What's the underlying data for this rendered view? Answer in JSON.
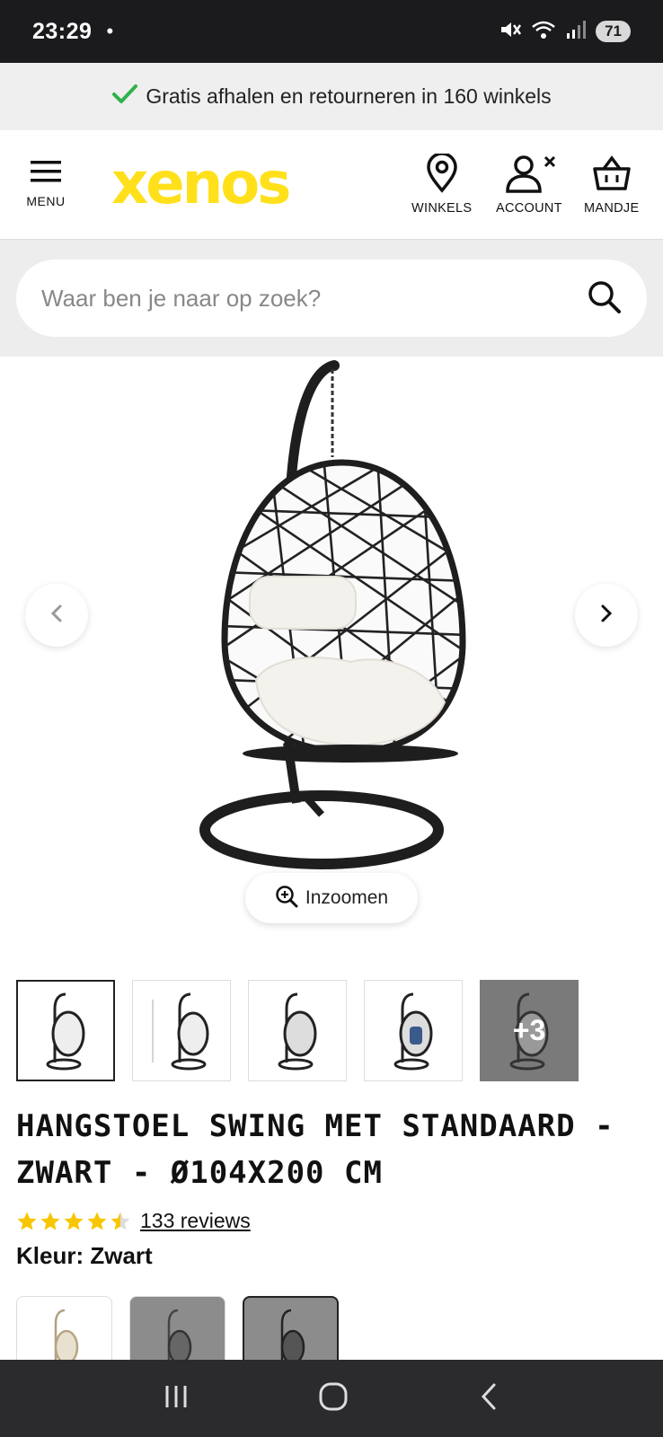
{
  "status_bar": {
    "time": "23:29",
    "dot": "•",
    "battery": "71"
  },
  "promo": {
    "text": "Gratis afhalen en retourneren in 160 winkels"
  },
  "header": {
    "menu_label": "MENU",
    "logo": "xenos",
    "stores_label": "WINKELS",
    "account_label": "ACCOUNT",
    "cart_label": "MANDJE"
  },
  "search": {
    "placeholder": "Waar ben je naar op zoek?"
  },
  "gallery": {
    "zoom_label": "Inzoomen",
    "more_label": "+3"
  },
  "product": {
    "title": "Hangstoel Swing met standaard - zwart - Ø104x200 cm",
    "rating": 4.5,
    "reviews_label": "133 reviews",
    "color_label": "Kleur: Zwart"
  },
  "colors": {
    "brand_yellow": "#ffe01b",
    "star": "#f7c600",
    "check": "#2fb24c"
  }
}
